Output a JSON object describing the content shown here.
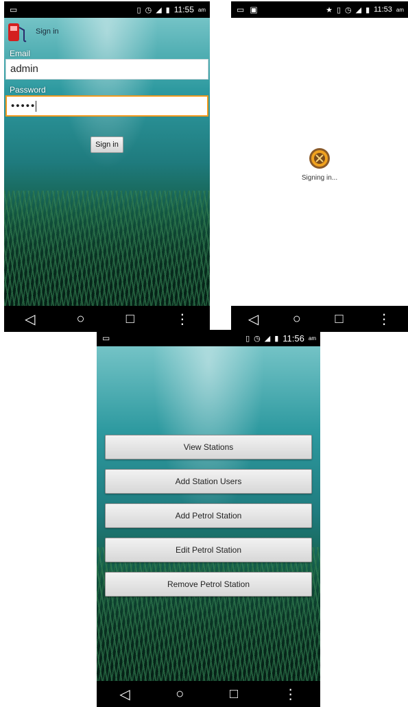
{
  "screen1": {
    "status": {
      "time": "11:55",
      "ampm": "am"
    },
    "title": "Sign in",
    "email_label": "Email",
    "email_value": "admin",
    "password_label": "Password",
    "password_value": "•••••",
    "signin_button": "Sign in"
  },
  "screen2": {
    "status": {
      "time": "11:53",
      "ampm": "am"
    },
    "loading_text": "Signing in..."
  },
  "screen3": {
    "status": {
      "time": "11:56",
      "ampm": "am"
    },
    "buttons": [
      "View Stations",
      "Add Station Users",
      "Add Petrol Station",
      "Edit Petrol Station",
      "Remove Petrol Station"
    ]
  },
  "nav": {
    "back": "◁",
    "home": "○",
    "recents": "□",
    "more": "⋮"
  },
  "colors": {
    "accent": "#f39a1e",
    "statusbar": "#000000"
  }
}
